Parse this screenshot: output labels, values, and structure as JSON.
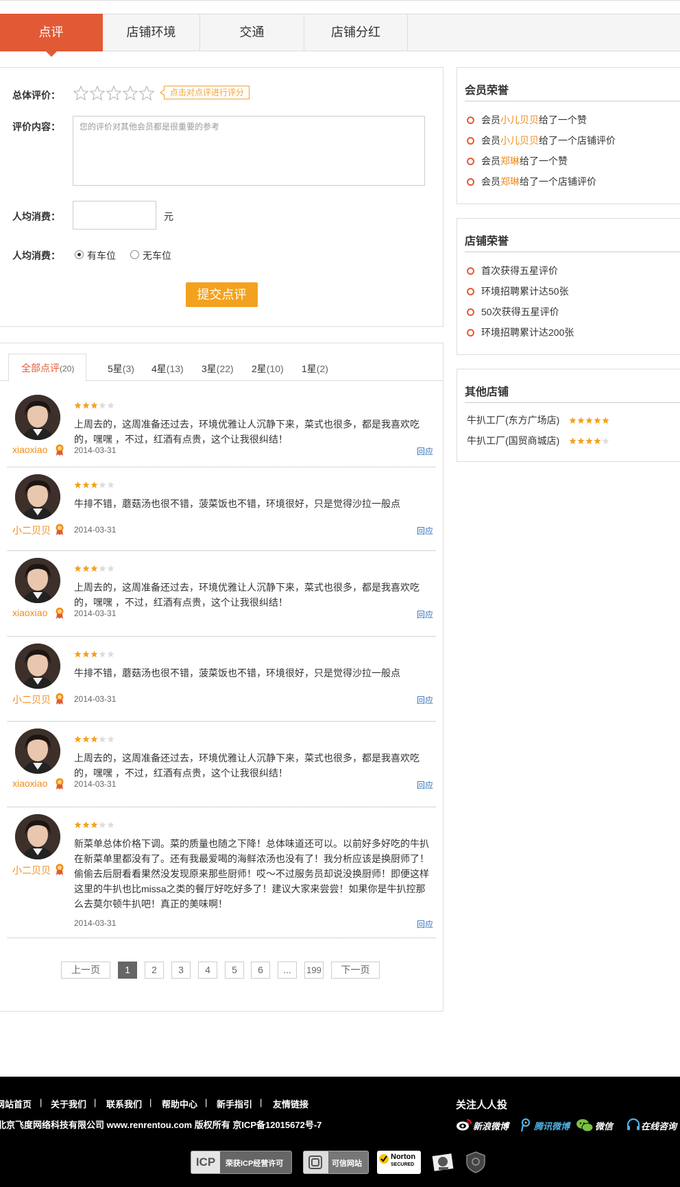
{
  "tabs": [
    {
      "label": "点评"
    },
    {
      "label": "店铺环境"
    },
    {
      "label": "交通"
    },
    {
      "label": "店铺分红"
    }
  ],
  "form": {
    "overall_label": "总体评价：",
    "rate_hint": "点击对点评进行评分",
    "content_label": "评价内容：",
    "content_placeholder": "您的评价对其他会员都是很重要的参考",
    "spend_label": "人均消费：",
    "spend_unit": "元",
    "parking_label": "人均消费：",
    "parking_yes": "有车位",
    "parking_no": "无车位",
    "parking_selected": "有车位",
    "submit": "提交点评"
  },
  "filters": [
    {
      "label": "全部点评",
      "count": "(20)"
    },
    {
      "label": "5星",
      "count": "(3)"
    },
    {
      "label": "4星",
      "count": "(13)"
    },
    {
      "label": "3星",
      "count": "(22)"
    },
    {
      "label": "2星",
      "count": "(10)"
    },
    {
      "label": "1星",
      "count": "(2)"
    }
  ],
  "reviews": [
    {
      "user": "xiaoxiao",
      "stars": 3,
      "text": "上周去的，这周准备还过去，环境优雅让人沉静下来，菜式也很多，都是我喜欢吃的，嘿嘿 ，不过，红酒有点贵，这个让我很纠结！",
      "date": "2014-03-31",
      "reply": "回应"
    },
    {
      "user": "小二贝贝",
      "stars": 3,
      "text": "牛排不错，蘑菇汤也很不错，菠菜饭也不错，环境很好，只是觉得沙拉一般点",
      "date": "2014-03-31",
      "reply": "回应"
    },
    {
      "user": "xiaoxiao",
      "stars": 3,
      "text": "上周去的，这周准备还过去，环境优雅让人沉静下来，菜式也很多，都是我喜欢吃的，嘿嘿 ，不过，红酒有点贵，这个让我很纠结！",
      "date": "2014-03-31",
      "reply": "回应"
    },
    {
      "user": "小二贝贝",
      "stars": 3,
      "text": "牛排不错，蘑菇汤也很不错，菠菜饭也不错，环境很好，只是觉得沙拉一般点",
      "date": "2014-03-31",
      "reply": "回应"
    },
    {
      "user": "xiaoxiao",
      "stars": 3,
      "text": "上周去的，这周准备还过去，环境优雅让人沉静下来，菜式也很多，都是我喜欢吃的，嘿嘿 ，不过，红酒有点贵，这个让我很纠结！",
      "date": "2014-03-31",
      "reply": "回应"
    },
    {
      "user": "小二贝贝",
      "stars": 3,
      "text": "新菜单总体价格下调。菜的质量也随之下降！总体味道还可以。以前好多好吃的牛扒在新菜单里都没有了。还有我最爱喝的海鲜浓汤也没有了！我分析应该是换厨师了！偷偷去后厨看看果然没发现原来那些厨师！哎～不过服务员却说没换厨师！即便这样这里的牛扒也比missa之类的餐厅好吃好多了！建议大家来尝尝！如果你是牛扒控那么去莫尔顿牛扒吧！真正的美味啊！",
      "date": "2014-03-31",
      "reply": "回应"
    }
  ],
  "pagination": {
    "prev": "上一页",
    "pages": [
      "1",
      "2",
      "3",
      "4",
      "5",
      "6",
      "...",
      "199"
    ],
    "current": "1",
    "next": "下一页"
  },
  "member_honor": {
    "title": "会员荣誉",
    "items": [
      {
        "pre": "会员",
        "name": "小儿贝贝",
        "post": "给了一个赞"
      },
      {
        "pre": "会员",
        "name": "小儿贝贝",
        "post": "给了一个店铺评价"
      },
      {
        "pre": "会员",
        "name": "郑琳",
        "post": "给了一个赞"
      },
      {
        "pre": "会员",
        "name": "郑琳",
        "post": "给了一个店铺评价"
      }
    ]
  },
  "shop_honor": {
    "title": "店铺荣誉",
    "items": [
      "首次获得五星评价",
      "环境招聘累计达50张",
      "50次获得五星评价",
      "环境招聘累计达200张"
    ]
  },
  "other_shops": {
    "title": "其他店铺",
    "items": [
      {
        "name": "牛扒工厂(东方广场店)",
        "stars": 5
      },
      {
        "name": "牛扒工厂(国贸商城店)",
        "stars": 4
      }
    ]
  },
  "footer": {
    "links": [
      "网站首页",
      "关于我们",
      "联系我们",
      "帮助中心",
      "新手指引",
      "友情链接"
    ],
    "separator": "|",
    "copyright": "北京飞度网络科技有限公司 www.renrentou.com 版权所有 京ICP备12015672号-7",
    "follow_title": "关注人人投",
    "social": [
      "新浪微博",
      "腾讯微博",
      "微信",
      "在线咨询"
    ],
    "badges": {
      "icp": "ICP",
      "icp_text": "荣获ICP经营许可",
      "credit": "可信网站",
      "norton": "Norton",
      "norton_sub": "SECURED"
    }
  },
  "colors": {
    "accent": "#e15a35",
    "orange": "#f3a21f",
    "username": "#f08c1a",
    "link": "#2a6ebb"
  }
}
